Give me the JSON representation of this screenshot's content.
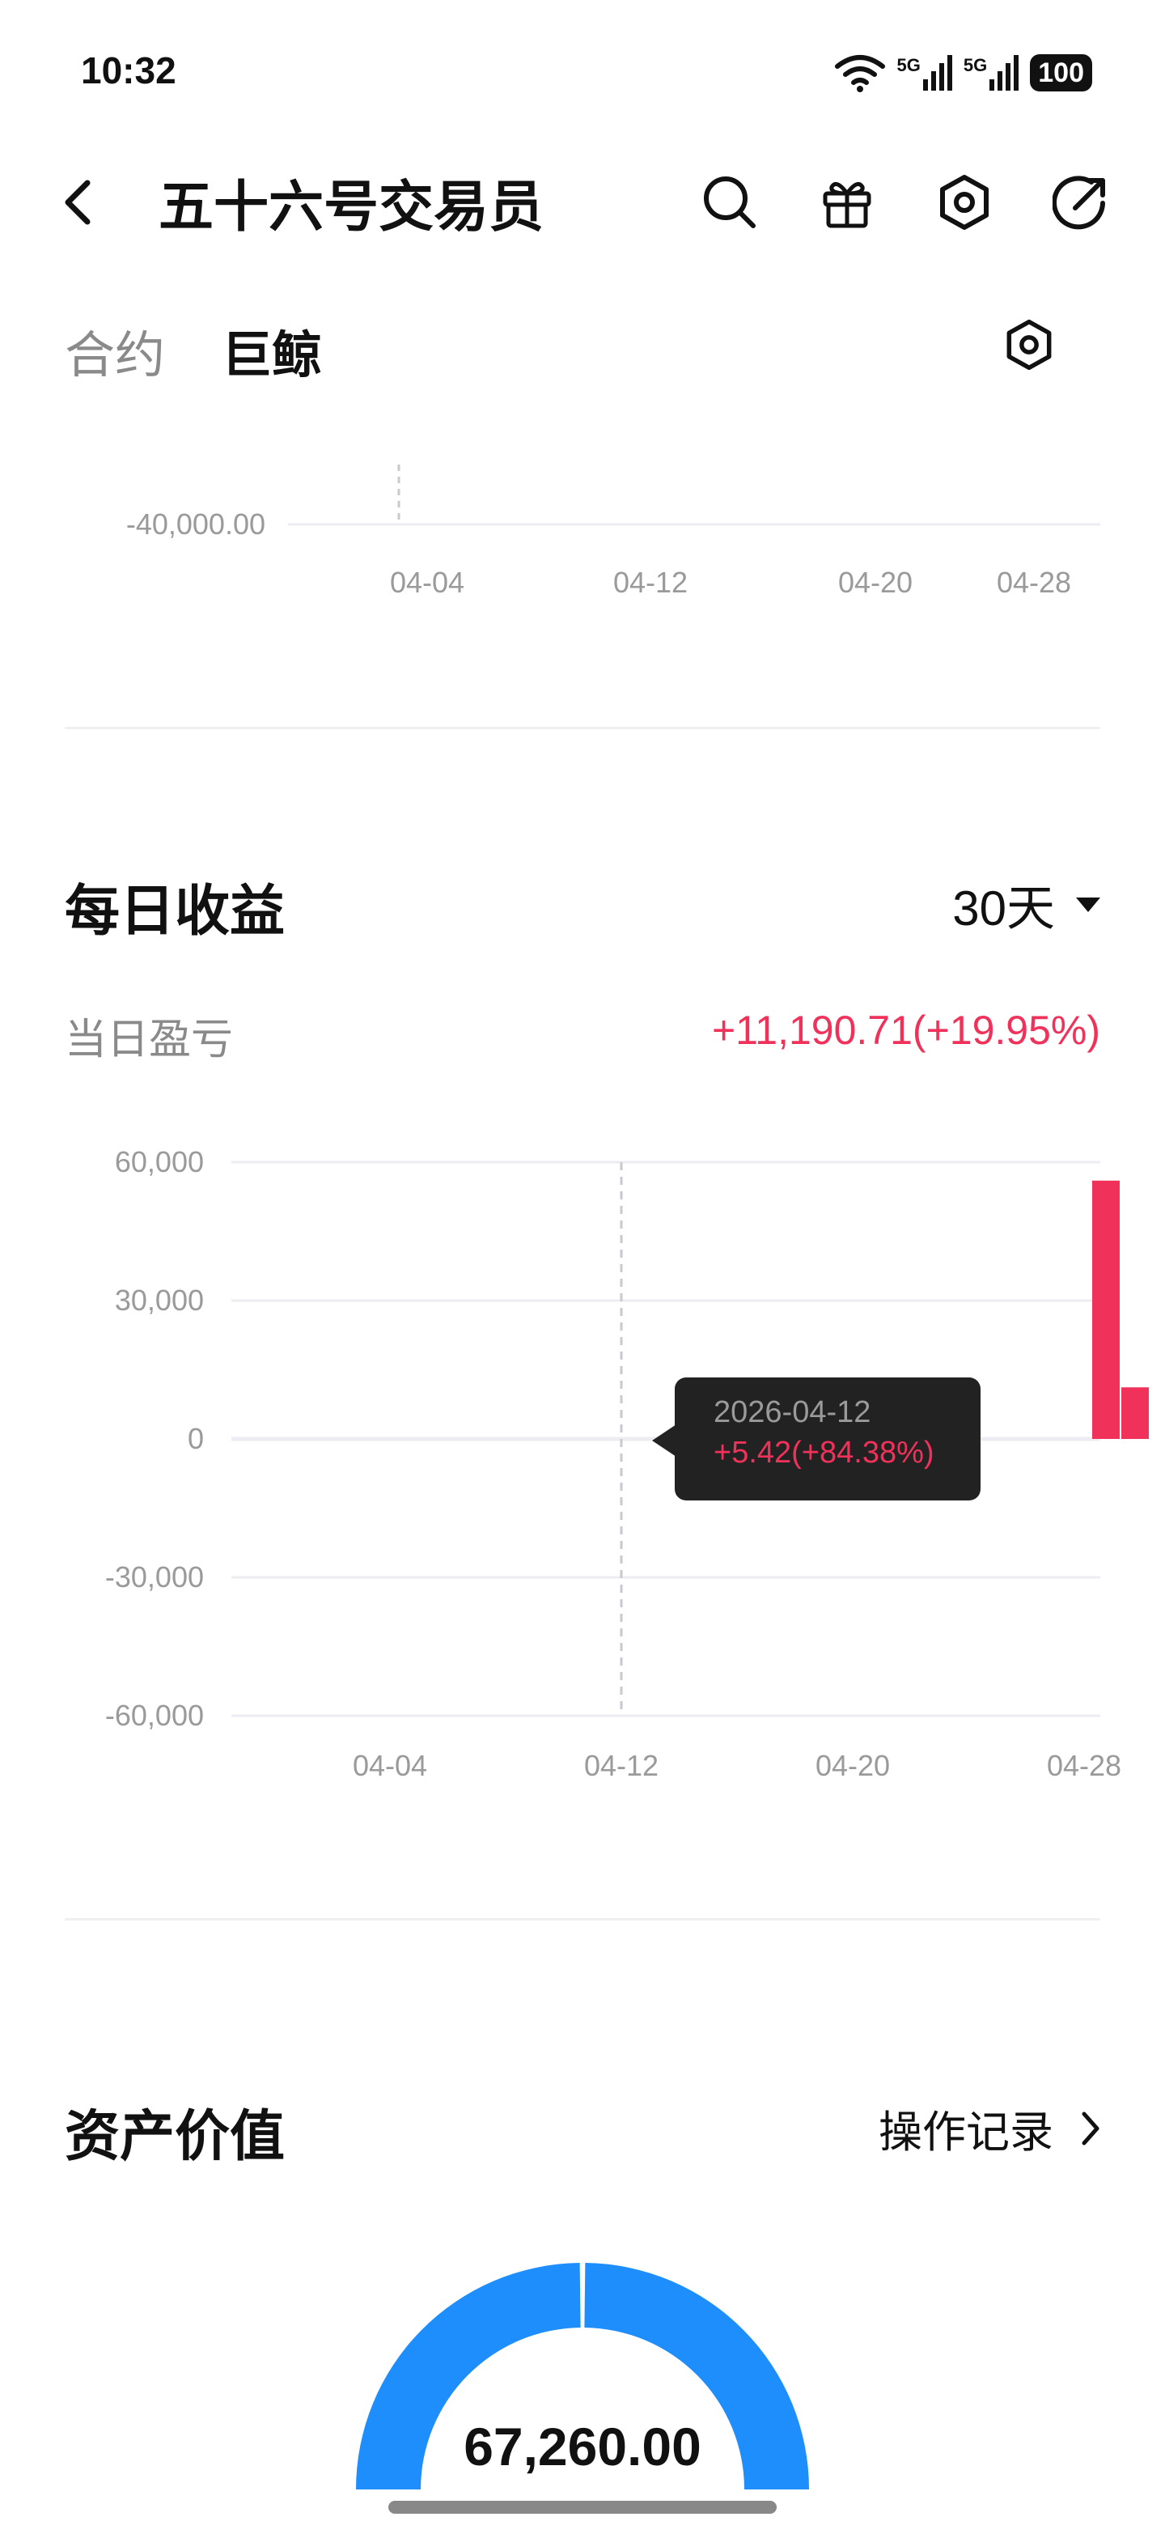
{
  "status_bar": {
    "time": "10:32",
    "signal1": "5G",
    "signal2": "5G",
    "battery": "100"
  },
  "header": {
    "title": "五十六号交易员"
  },
  "tabs": [
    {
      "label": "合约"
    },
    {
      "label": "巨鲸"
    }
  ],
  "icons": {
    "back": "chevron-left-icon",
    "search": "search-icon",
    "gift": "gift-icon",
    "settings": "hexagon-gear-icon",
    "share": "share-arrow-icon"
  },
  "top_chart": {
    "y_tick": "-40,000.00",
    "x_ticks": [
      "04-04",
      "04-12",
      "04-20",
      "04-28"
    ]
  },
  "daily_pnl": {
    "title": "每日收益",
    "range": "30天",
    "label": "当日盈亏",
    "value": "+11,190.71(+19.95%)",
    "tooltip": {
      "date": "2026-04-12",
      "value": "+5.42(+84.38%)"
    }
  },
  "chart_data": {
    "type": "bar",
    "x_ticks": [
      "04-04",
      "04-12",
      "04-20",
      "04-28"
    ],
    "y_ticks": [
      "60,000",
      "30,000",
      "0",
      "-30,000",
      "-60,000"
    ],
    "ylim": [
      -60000,
      60000
    ],
    "series": [
      {
        "values": [
          {
            "x": "04-12",
            "y": 5.42
          },
          {
            "x": "04-28",
            "y": 56000
          },
          {
            "x": "04-29",
            "y": 11190.71
          }
        ]
      }
    ],
    "colors": {
      "positive": "#f0325a",
      "grid": "#ececf2",
      "tick": "#9a9a9a"
    }
  },
  "assets": {
    "title": "资产价值",
    "link": "操作记录",
    "value": "67,260.00",
    "gauge_color": "#1e8efc"
  }
}
